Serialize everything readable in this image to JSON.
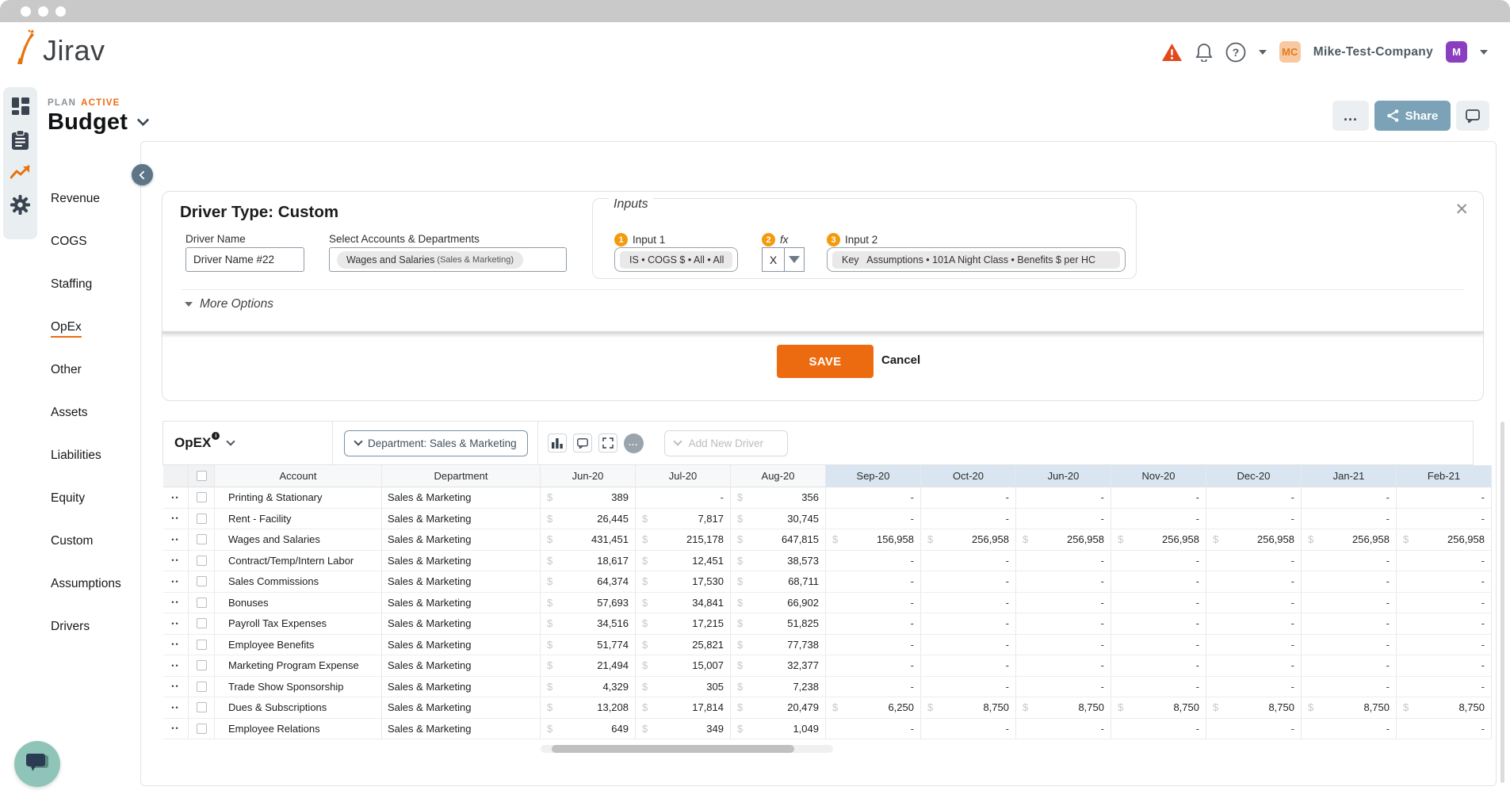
{
  "window": {
    "dots": [
      "close",
      "minimize",
      "maximize"
    ]
  },
  "brand": {
    "logo_text": "Jirav"
  },
  "topbar": {
    "company": "Mike-Test-Company",
    "avatar_company": "MC",
    "avatar_user": "M"
  },
  "plan": {
    "eyebrow_plan": "PLAN",
    "eyebrow_status": "ACTIVE",
    "title": "Budget"
  },
  "header_actions": {
    "more_label": "...",
    "share_label": "Share"
  },
  "sidebar": {
    "items": [
      {
        "label": "Revenue",
        "active": false
      },
      {
        "label": "COGS",
        "active": false
      },
      {
        "label": "Staffing",
        "active": false
      },
      {
        "label": "OpEx",
        "active": true
      },
      {
        "label": "Other",
        "active": false
      },
      {
        "label": "Assets",
        "active": false
      },
      {
        "label": "Liabilities",
        "active": false
      },
      {
        "label": "Equity",
        "active": false
      },
      {
        "label": "Custom",
        "active": false
      },
      {
        "label": "Assumptions",
        "active": false
      },
      {
        "label": "Drivers",
        "active": false
      }
    ]
  },
  "driver_panel": {
    "title": "Driver Type: Custom",
    "driver_name_label": "Driver Name",
    "driver_name_value": "Driver Name #22",
    "accounts_label": "Select Accounts & Departments",
    "accounts_value": "Wages and Salaries",
    "accounts_value_suffix": "(Sales & Marketing)",
    "inputs_legend": "Inputs",
    "input1_badge": "1",
    "input1_label": "Input 1",
    "input1_value": "IS • COGS $ • All • All",
    "fx_badge": "2",
    "fx_label": "fx",
    "fx_value": "X",
    "input2_badge": "3",
    "input2_label": "Input 2",
    "input2_value": "Key   Assumptions • 101A Night Class • Benefits $ per HC",
    "more_options": "More Options",
    "save_label": "SAVE",
    "cancel_label": "Cancel"
  },
  "opex": {
    "title": "OpEX",
    "department_filter": "Department: Sales & Marketing",
    "add_new_driver": "Add New Driver",
    "ellipsis": "..."
  },
  "table": {
    "left_columns": [
      "Account",
      "Department"
    ],
    "month_columns": [
      "Jun-20",
      "Jul-20",
      "Aug-20",
      "Sep-20",
      "Oct-20",
      "Jun-20",
      "Nov-20",
      "Dec-20",
      "Jan-21",
      "Feb-21"
    ],
    "highlight_from_month_index": 3,
    "currency_symbol": "$",
    "rows": [
      {
        "account": "Printing & Stationary",
        "department": "Sales & Marketing",
        "values": [
          "389",
          "-",
          "356",
          "-",
          "-",
          "-",
          "-",
          "-",
          "-",
          "-"
        ]
      },
      {
        "account": "Rent - Facility",
        "department": "Sales & Marketing",
        "values": [
          "26,445",
          "7,817",
          "30,745",
          "-",
          "-",
          "-",
          "-",
          "-",
          "-",
          "-"
        ]
      },
      {
        "account": "Wages and Salaries",
        "department": "Sales & Marketing",
        "values": [
          "431,451",
          "215,178",
          "647,815",
          "156,958",
          "256,958",
          "256,958",
          "256,958",
          "256,958",
          "256,958",
          "256,958"
        ]
      },
      {
        "account": "Contract/Temp/Intern Labor",
        "department": "Sales & Marketing",
        "values": [
          "18,617",
          "12,451",
          "38,573",
          "-",
          "-",
          "-",
          "-",
          "-",
          "-",
          "-"
        ]
      },
      {
        "account": "Sales Commissions",
        "department": "Sales & Marketing",
        "values": [
          "64,374",
          "17,530",
          "68,711",
          "-",
          "-",
          "-",
          "-",
          "-",
          "-",
          "-"
        ]
      },
      {
        "account": "Bonuses",
        "department": "Sales & Marketing",
        "values": [
          "57,693",
          "34,841",
          "66,902",
          "-",
          "-",
          "-",
          "-",
          "-",
          "-",
          "-"
        ]
      },
      {
        "account": "Payroll Tax Expenses",
        "department": "Sales & Marketing",
        "values": [
          "34,516",
          "17,215",
          "51,825",
          "-",
          "-",
          "-",
          "-",
          "-",
          "-",
          "-"
        ]
      },
      {
        "account": "Employee Benefits",
        "department": "Sales & Marketing",
        "values": [
          "51,774",
          "25,821",
          "77,738",
          "-",
          "-",
          "-",
          "-",
          "-",
          "-",
          "-"
        ]
      },
      {
        "account": "Marketing Program Expense",
        "department": "Sales & Marketing",
        "values": [
          "21,494",
          "15,007",
          "32,377",
          "-",
          "-",
          "-",
          "-",
          "-",
          "-",
          "-"
        ]
      },
      {
        "account": "Trade Show Sponsorship",
        "department": "Sales & Marketing",
        "values": [
          "4,329",
          "305",
          "7,238",
          "-",
          "-",
          "-",
          "-",
          "-",
          "-",
          "-"
        ]
      },
      {
        "account": "Dues & Subscriptions",
        "department": "Sales & Marketing",
        "values": [
          "13,208",
          "17,814",
          "20,479",
          "6,250",
          "8,750",
          "8,750",
          "8,750",
          "8,750",
          "8,750",
          "8,750"
        ]
      },
      {
        "account": "Employee Relations",
        "department": "Sales & Marketing",
        "values": [
          "649",
          "349",
          "1,049",
          "-",
          "-",
          "-",
          "-",
          "-",
          "-",
          "-"
        ]
      }
    ]
  },
  "colors": {
    "accent": "#ED6B10",
    "badge_orange": "#F39B0C",
    "warning_red": "#E2491B",
    "share_blue": "#7BA2B6",
    "header_blue": "#D9E5F0",
    "fab_teal": "#8FC5B8",
    "fab_bubble": "#2B3B52",
    "avatar_mc_bg": "#F8C9A0",
    "avatar_mc_text": "#E07C1F",
    "avatar_m_bg": "#8A3FC0",
    "titlebar_gray": "#C9C9C9",
    "rail_icon": "#3A4450"
  }
}
